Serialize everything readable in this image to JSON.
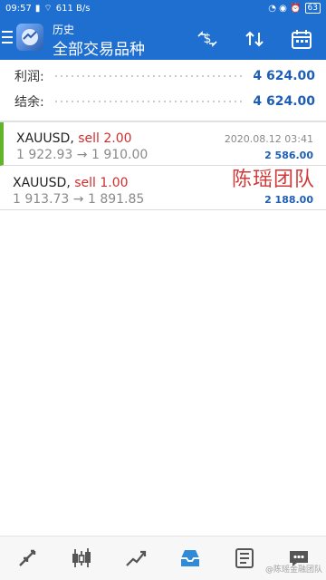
{
  "status": {
    "time": "09:57",
    "speed": "611 B/s",
    "battery": "63"
  },
  "header": {
    "subtitle": "历史",
    "title": "全部交易品种"
  },
  "summary": {
    "profit_label": "利润:",
    "profit_value": "4 624.00",
    "balance_label": "结余:",
    "balance_value": "4 624.00"
  },
  "trades": [
    {
      "symbol": "XAUUSD,",
      "side": "sell 2.00",
      "prices": "1 922.93 → 1 910.00",
      "time": "2020.08.12 03:41",
      "profit": "2 586.00"
    },
    {
      "symbol": "XAUUSD,",
      "side": "sell 1.00",
      "prices": "1 913.73 → 1 891.85",
      "time": "",
      "profit": "2 188.00"
    }
  ],
  "watermark": "陈瑶团队",
  "bottom_watermark": "@陈瑶金融团队",
  "icons": {
    "toolbar": [
      "currency-switch-icon",
      "sort-icon",
      "calendar-icon"
    ],
    "bottom": [
      "quotes-icon",
      "chart-candles-icon",
      "trade-icon",
      "history-icon",
      "news-icon",
      "chat-icon"
    ]
  },
  "colors": {
    "primary": "#1f6fd0",
    "value_blue": "#1e5fb5",
    "sell_red": "#d02d2d",
    "active_green": "#62b52a"
  }
}
